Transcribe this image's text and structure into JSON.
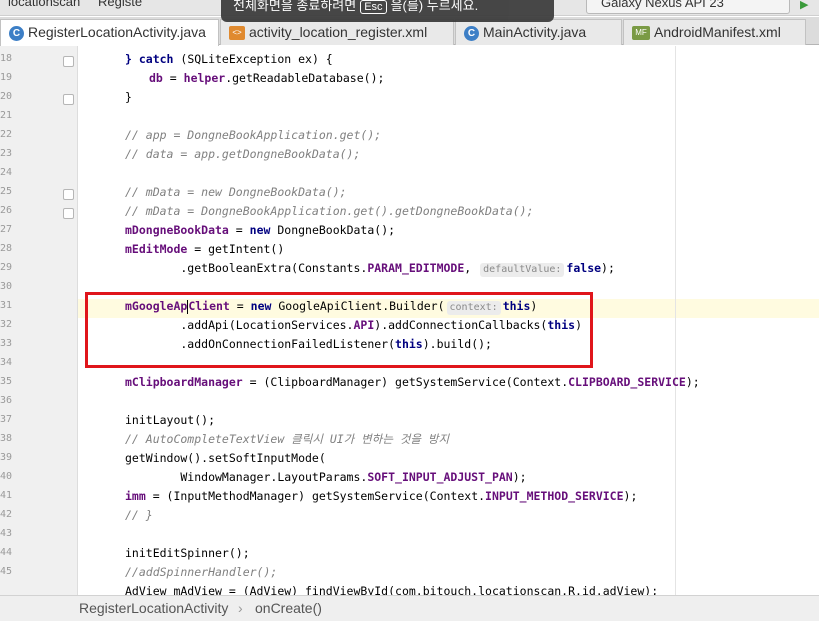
{
  "top": {
    "crumb1": "locationscan",
    "crumb2": "Registe",
    "device": "Galaxy Nexus API 23",
    "toast_before": "전체화면을 종료하려면",
    "toast_key": "Esc",
    "toast_after": "을(를) 누르세요."
  },
  "tabs": [
    {
      "label": "RegisterLocationActivity.java",
      "icon": "java-class-icon",
      "active": true
    },
    {
      "label": "activity_location_register.xml",
      "icon": "xml-layout-icon",
      "active": false
    },
    {
      "label": "MainActivity.java",
      "icon": "java-class-icon",
      "active": false
    },
    {
      "label": "AndroidManifest.xml",
      "icon": "manifest-icon",
      "active": false
    }
  ],
  "gutter": {
    "line_numbers": [
      "18",
      "19",
      "20",
      "21",
      "22",
      "23",
      "24",
      "25",
      "26",
      "27",
      "28",
      "29",
      "30",
      "31",
      "32",
      "33",
      "34",
      "35",
      "36",
      "37",
      "38",
      "39",
      "40",
      "41",
      "42",
      "43",
      "44",
      "45"
    ]
  },
  "code": {
    "l18_kw": "} catch",
    "l18_rest": " (SQLiteException ex) {",
    "l19_var": "db",
    "l19_rest": " = ",
    "l19_fld": "helper",
    "l19_end": ".getReadableDatabase();",
    "l20": "}",
    "l22": "// app = DongneBookApplication.get();",
    "l23": "// data = app.getDongneBookData();",
    "l25": "// mData = new DongneBookData();",
    "l26": "// mData = DongneBookApplication.get().getDongneBookData();",
    "l27_fld": "mDongneBookData",
    "l27_mid": " = ",
    "l27_kw": "new",
    "l27_end": " DongneBookData();",
    "l28_fld": "mEditMode",
    "l28_end": " = getIntent()",
    "l29_a": "        .getBooleanExtra(Constants.",
    "l29_fld": "PARAM_EDITMODE",
    "l29_b": ",",
    "l29_hint": "defaultValue:",
    "l29_kw": "false",
    "l29_end": ");",
    "l31_fld_a": "mGoogleAp",
    "l31_fld_b": "Client",
    "l31_mid": " = ",
    "l31_kw": "new",
    "l31_cls": " GoogleApiClient.Builder(",
    "l31_hint": "context:",
    "l31_this": "this",
    "l31_end": ")",
    "l32_a": "        .addApi(LocationServices.",
    "l32_fld": "API",
    "l32_b": ").addConnectionCallbacks(",
    "l32_kw": "this",
    "l32_end": ")",
    "l33_a": "        .addOnConnectionFailedListener(",
    "l33_kw": "this",
    "l33_end": ").build();",
    "l35_fld": "mClipboardManager",
    "l35_a": " = (ClipboardManager) getSystemService(Context.",
    "l35_fld2": "CLIPBOARD_SERVICE",
    "l35_end": ");",
    "l37": "initLayout();",
    "l38": "// AutoCompleteTextView 클릭시 UI가 변하는 것을 방지",
    "l39": "getWindow().setSoftInputMode(",
    "l40_a": "        WindowManager.LayoutParams.",
    "l40_fld": "SOFT_INPUT_ADJUST_PAN",
    "l40_end": ");",
    "l41_fld": "imm",
    "l41_a": " = (InputMethodManager) getSystemService(Context.",
    "l41_fld2": "INPUT_METHOD_SERVICE",
    "l41_end": ");",
    "l42": "// }",
    "l44": "initEditSpinner();",
    "l45": "//addSpinnerHandler();",
    "l46": "AdView mAdView = (AdView) findViewById(com.bitouch.locationscan.R.id.adView);"
  },
  "status": {
    "class_name": "RegisterLocationActivity",
    "separator": "›",
    "method_name": "onCreate()"
  },
  "colors": {
    "keyword": "#000080",
    "field": "#660e7a",
    "comment": "#808080",
    "annotation_box": "#e0151b",
    "caret_line": "#fffbe0"
  }
}
